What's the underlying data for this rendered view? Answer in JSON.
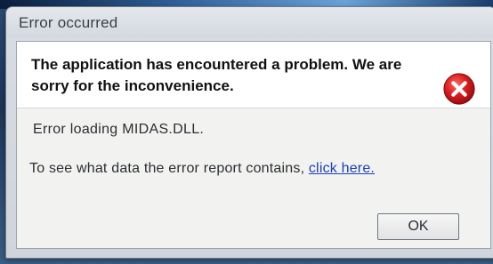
{
  "window": {
    "title": "Error occurred"
  },
  "message": {
    "headline": "The application has encountered a problem. We are sorry for the inconvenience.",
    "detail": "Error loading MIDAS.DLL.",
    "report_prefix": "To see what data the error report contains, ",
    "report_link": "click here."
  },
  "buttons": {
    "ok_label": "OK"
  },
  "icons": {
    "status": "error-icon"
  },
  "colors": {
    "error_red": "#d0171b",
    "link_blue": "#1d3fb8"
  }
}
